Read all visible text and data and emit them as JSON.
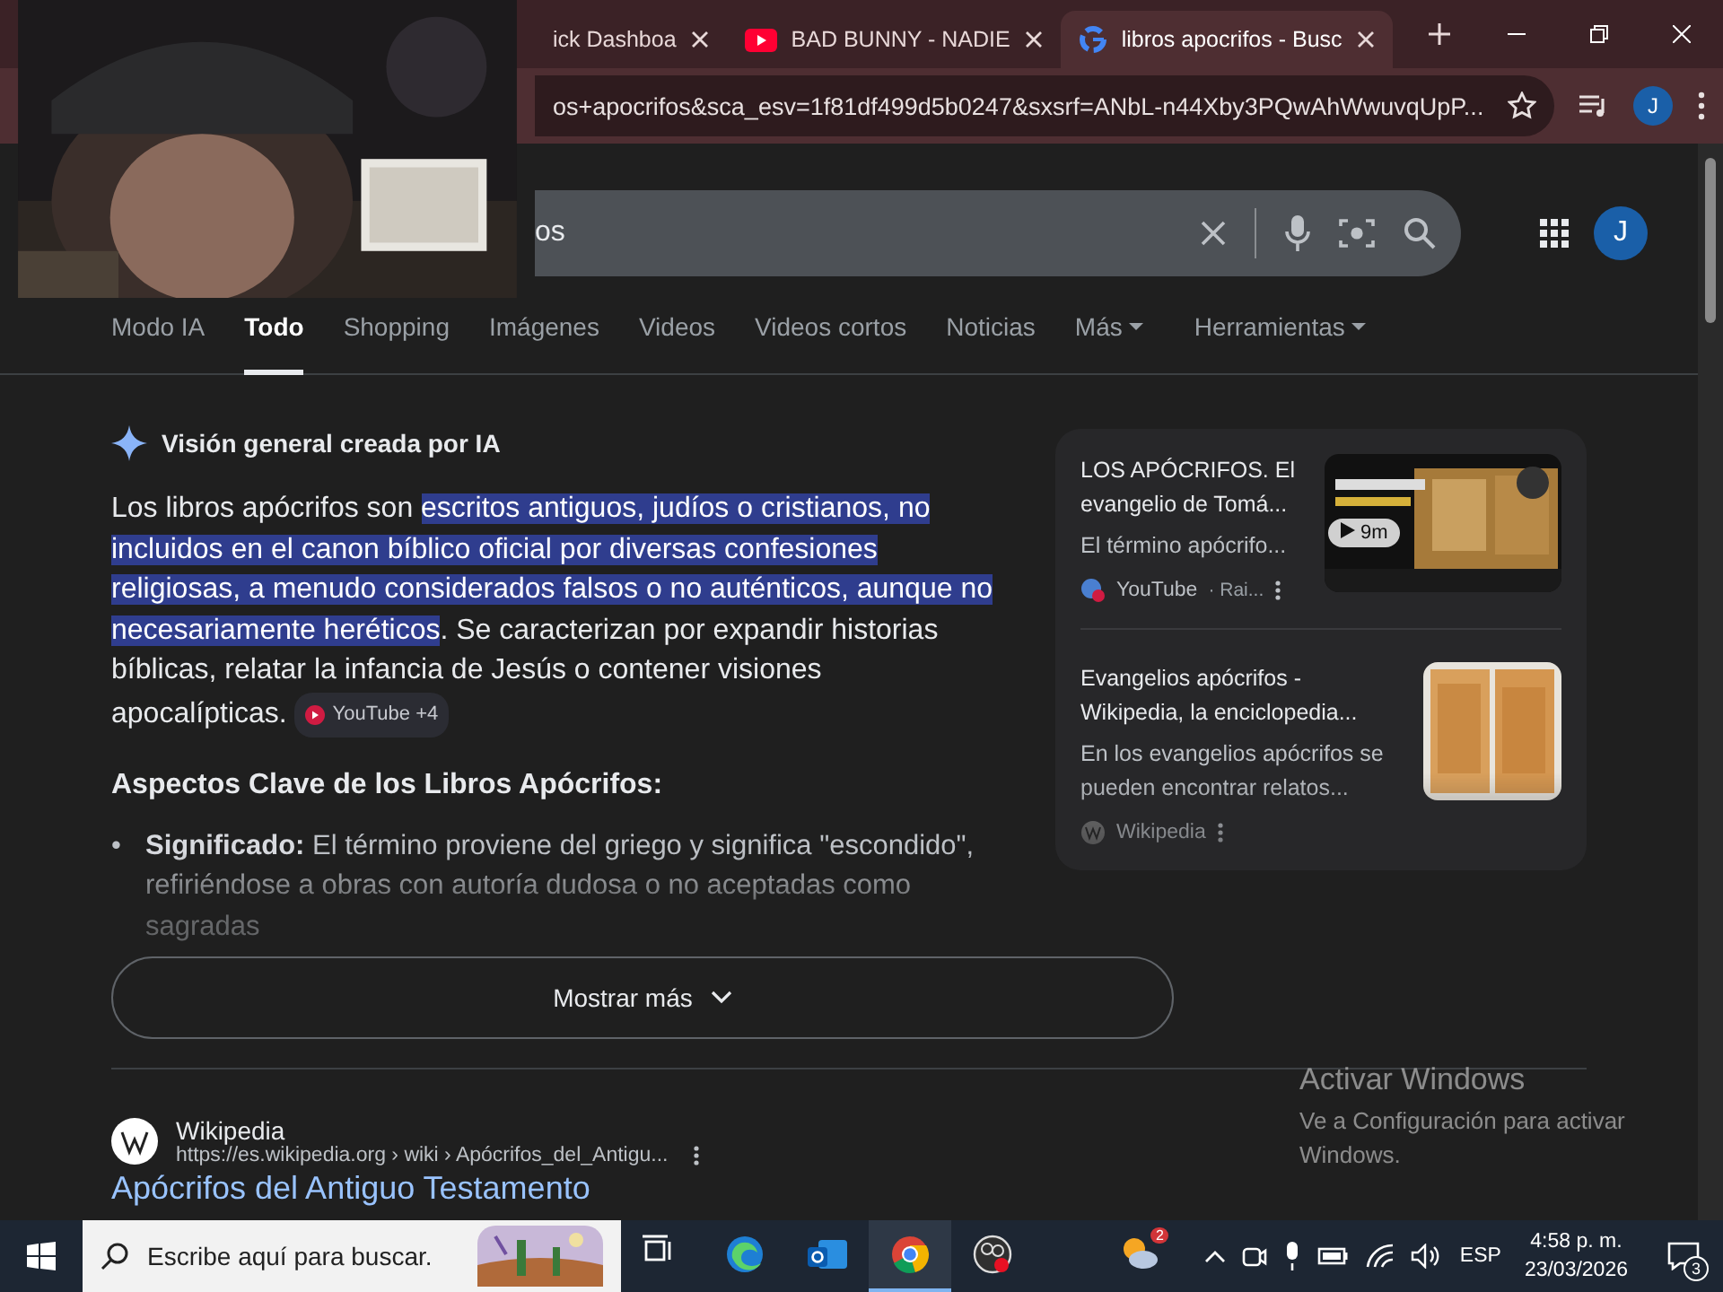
{
  "browser": {
    "tabs": [
      {
        "title": "ick Dashboa",
        "selected": false
      },
      {
        "title": "BAD BUNNY - NADIE",
        "selected": false
      },
      {
        "title": "libros apocrifos - Busc",
        "selected": true
      }
    ],
    "address": "os+apocrifos&sca_esv=1f81df499d5b0247&sxsrf=ANbL-n44Xby3PQwAhWwuvqUpP...",
    "profile_initial": "J"
  },
  "search": {
    "value": "os",
    "profile_initial": "J"
  },
  "nav": [
    {
      "label": "Modo IA",
      "selected": false,
      "dropdown": false
    },
    {
      "label": "Todo",
      "selected": true,
      "dropdown": false
    },
    {
      "label": "Shopping",
      "selected": false,
      "dropdown": false
    },
    {
      "label": "Imágenes",
      "selected": false,
      "dropdown": false
    },
    {
      "label": "Videos",
      "selected": false,
      "dropdown": false
    },
    {
      "label": "Videos cortos",
      "selected": false,
      "dropdown": false
    },
    {
      "label": "Noticias",
      "selected": false,
      "dropdown": false
    },
    {
      "label": "Más",
      "selected": false,
      "dropdown": true
    },
    {
      "label": "Herramientas",
      "selected": false,
      "dropdown": true
    }
  ],
  "ai_overview": {
    "title": "Visión general creada por IA",
    "paragraph": [
      {
        "text": "Los libros apócrifos son ",
        "highlighted": false
      },
      {
        "text": "escritos antiguos, judíos o cristianos, no incluidos en el canon bíblico oficial por diversas confesiones religiosas, a menudo considerados falsos o no auténticos, aunque no necesariamente heréticos",
        "highlighted": true
      },
      {
        "text": ". Se caracterizan por expandir historias bíblicas, relatar la infancia de Jesús o contener visiones apocalípticas.",
        "highlighted": false
      }
    ],
    "source_chip": "YouTube +4",
    "heading": "Aspectos Clave de los Libros Apócrifos:",
    "bullets": [
      {
        "marker": "•",
        "term": "Significado:",
        "text": "El término proviene del griego y significa \"escondido\", refiriéndose a obras con autoría dudosa o no aceptadas como sagradas"
      }
    ],
    "sources": [
      {
        "title": "LOS APÓCRIFOS. El evangelio de Tomá...",
        "snippet": "El término apócrifo...",
        "site": "YouTube",
        "meta": "· Rai...",
        "kind": "video",
        "duration": "9m",
        "faded": false
      },
      {
        "title": "Evangelios apócrifos - Wikipedia, la enciclopedia...",
        "snippet": "En los evangelios apócrifos se pueden encontrar relatos...",
        "site": "Wikipedia",
        "kind": "article",
        "faded": true
      }
    ],
    "show_more": "Mostrar más"
  },
  "results": [
    {
      "site": "Wikipedia",
      "url": "https://es.wikipedia.org › wiki › Apócrifos_del_Antigu...",
      "title": "Apócrifos del Antiguo Testamento"
    }
  ],
  "activation": {
    "title": "Activar Windows",
    "text": "Ve a Configuración para activar Windows."
  },
  "taskbar": {
    "search_placeholder": "Escribe aquí para buscar.",
    "apps": [
      {
        "kind": "taskview",
        "active": false
      },
      {
        "kind": "edge",
        "active": false
      },
      {
        "kind": "outlook",
        "active": false
      },
      {
        "kind": "chrome",
        "active": true
      },
      {
        "kind": "obs",
        "active": false
      }
    ],
    "weather_badge": "2",
    "language": "ESP",
    "time": "4:58 p. m.",
    "date": "23/03/2026",
    "notifications": "3"
  }
}
